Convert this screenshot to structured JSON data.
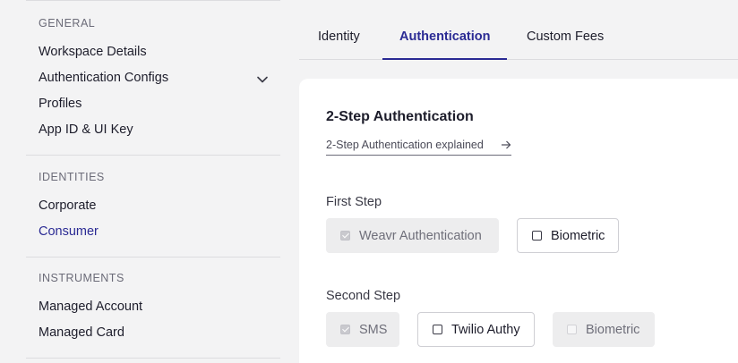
{
  "sidebar": {
    "sections": [
      {
        "label": "GENERAL",
        "items": [
          {
            "label": "Workspace Details"
          },
          {
            "label": "Authentication Configs"
          },
          {
            "label": "Profiles"
          },
          {
            "label": "App ID & UI Key"
          }
        ]
      },
      {
        "label": "IDENTITIES",
        "items": [
          {
            "label": "Corporate"
          },
          {
            "label": "Consumer",
            "active": true
          }
        ]
      },
      {
        "label": "INSTRUMENTS",
        "items": [
          {
            "label": "Managed Account"
          },
          {
            "label": "Managed Card"
          }
        ]
      }
    ]
  },
  "tabs": [
    {
      "label": "Identity"
    },
    {
      "label": "Authentication",
      "active": true
    },
    {
      "label": "Custom Fees"
    }
  ],
  "card": {
    "title": "2-Step Authentication",
    "explain_link": "2-Step Authentication explained",
    "first_step": {
      "label": "First Step",
      "options": [
        {
          "label": "Weavr Authentication",
          "checked": true,
          "disabled": true
        },
        {
          "label": "Biometric",
          "checked": false,
          "disabled": false
        }
      ]
    },
    "second_step": {
      "label": "Second Step",
      "options": [
        {
          "label": "SMS",
          "checked": true,
          "disabled": true
        },
        {
          "label": "Twilio Authy",
          "checked": false,
          "disabled": false
        },
        {
          "label": "Biometric",
          "checked": false,
          "disabled": true
        }
      ]
    }
  },
  "colors": {
    "accent": "#2b2b94",
    "background": "#f3f3f4",
    "card": "#ffffff",
    "disabled_option": "#ededee"
  }
}
